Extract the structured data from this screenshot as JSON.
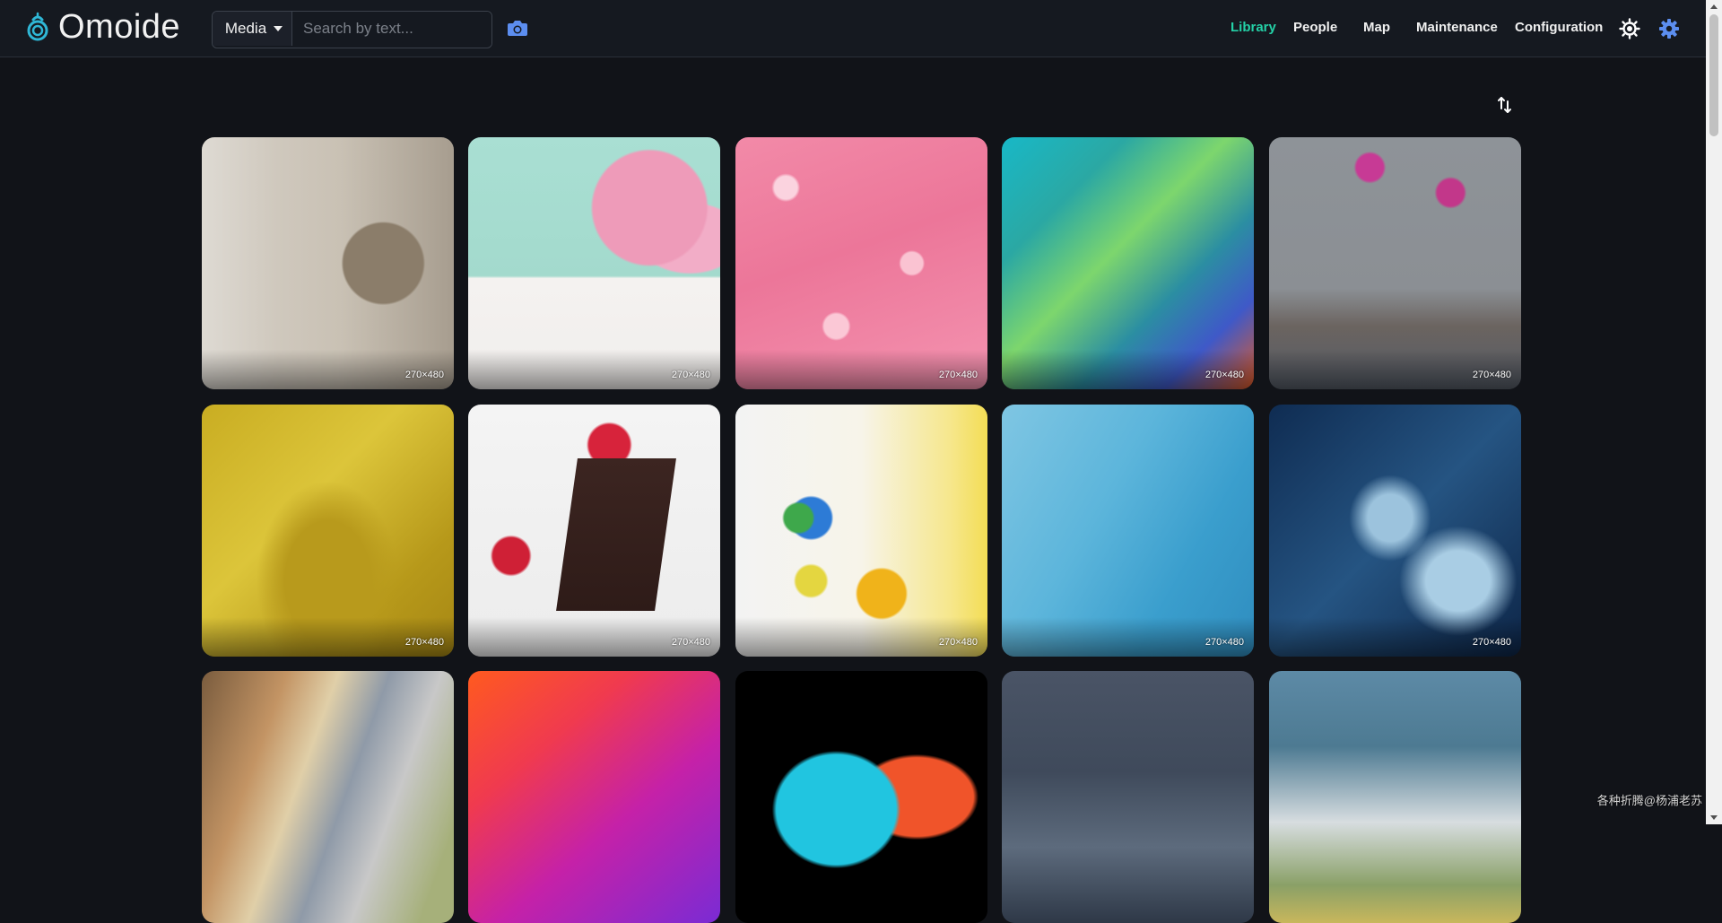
{
  "app": {
    "brand": "Omoide",
    "colors": {
      "accent": "#24d1a7",
      "background": "#111318",
      "navbar": "#151920",
      "icon_blue": "#5c8ef0"
    }
  },
  "search": {
    "scope_label": "Media",
    "placeholder": "Search by text...",
    "value": "",
    "camera_icon": "camera-icon"
  },
  "nav": {
    "items": [
      {
        "label": "Library",
        "active": true
      },
      {
        "label": "People",
        "active": false
      },
      {
        "label": "Map",
        "active": false
      },
      {
        "label": "Maintenance",
        "active": false
      },
      {
        "label": "Configuration",
        "active": false
      }
    ],
    "icons": [
      "brightness-icon",
      "gear-icon"
    ]
  },
  "toolbar": {
    "sort_icon": "sort-icon"
  },
  "gallery": {
    "items": [
      {
        "size": "270×480"
      },
      {
        "size": "270×480"
      },
      {
        "size": "270×480"
      },
      {
        "size": "270×480"
      },
      {
        "size": "270×480"
      },
      {
        "size": "270×480"
      },
      {
        "size": "270×480"
      },
      {
        "size": "270×480"
      },
      {
        "size": "270×480"
      },
      {
        "size": "270×480"
      },
      {
        "size": ""
      },
      {
        "size": ""
      },
      {
        "size": ""
      },
      {
        "size": ""
      },
      {
        "size": ""
      }
    ]
  },
  "watermark": "各种折腾@杨浦老苏"
}
